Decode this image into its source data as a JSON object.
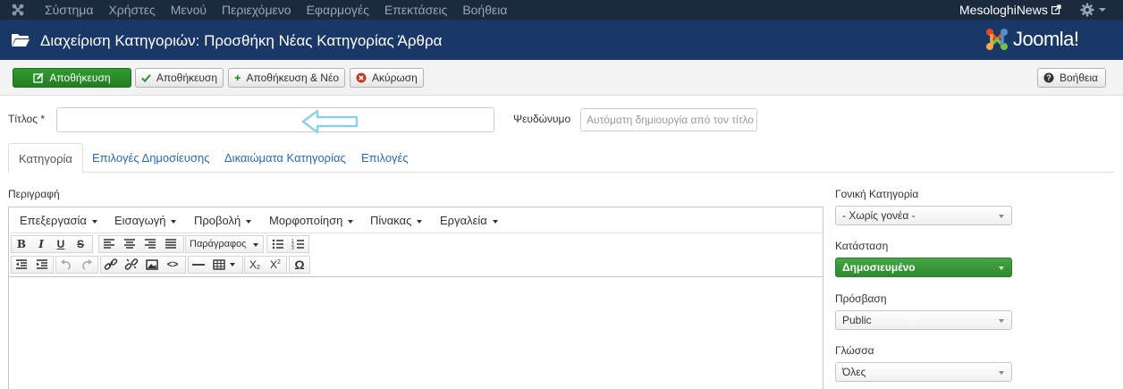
{
  "topnav": {
    "menu": [
      "Σύστημα",
      "Χρήστες",
      "Μενού",
      "Περιεχόμενο",
      "Εφαρμογές",
      "Επεκτάσεις",
      "Βοήθεια"
    ],
    "site_name": "MesologhiNews"
  },
  "titlebar": {
    "title": "Διαχείριση Κατηγοριών: Προσθήκη Νέας Κατηγορίας Άρθρα",
    "brand": "Joomla!"
  },
  "toolbar": {
    "save_close": "Αποθήκευση",
    "save": "Αποθήκευση",
    "save_new": "Αποθήκευση & Νέο",
    "cancel": "Ακύρωση",
    "help": "Βοήθεια"
  },
  "form": {
    "title_label": "Τίτλος *",
    "title_value": "",
    "alias_label": "Ψευδώνυμο",
    "alias_placeholder": "Αυτόματη δημιουργία από τον τίτλο"
  },
  "tabs": [
    "Κατηγορία",
    "Επιλογές Δημοσίευσης",
    "Δικαιώματα Κατηγορίας",
    "Επιλογές"
  ],
  "editor": {
    "label": "Περιγραφή",
    "menus": [
      "Επεξεργασία",
      "Εισαγωγή",
      "Προβολή",
      "Μορφοποίηση",
      "Πίνακας",
      "Εργαλεία"
    ],
    "format_select": "Παράγραφος"
  },
  "sidebar": {
    "parent_label": "Γονική Κατηγορία",
    "parent_value": "- Χωρίς γονέα -",
    "status_label": "Κατάσταση",
    "status_value": "Δημοσιευμένο",
    "access_label": "Πρόσβαση",
    "access_value": "Public",
    "language_label": "Γλώσσα",
    "language_value": "Όλες"
  },
  "colors": {
    "topnav_bg": "#1b2a3c",
    "titlebar_bg": "#1a3867",
    "green": "#2f9c2f",
    "link": "#2a69b8"
  }
}
